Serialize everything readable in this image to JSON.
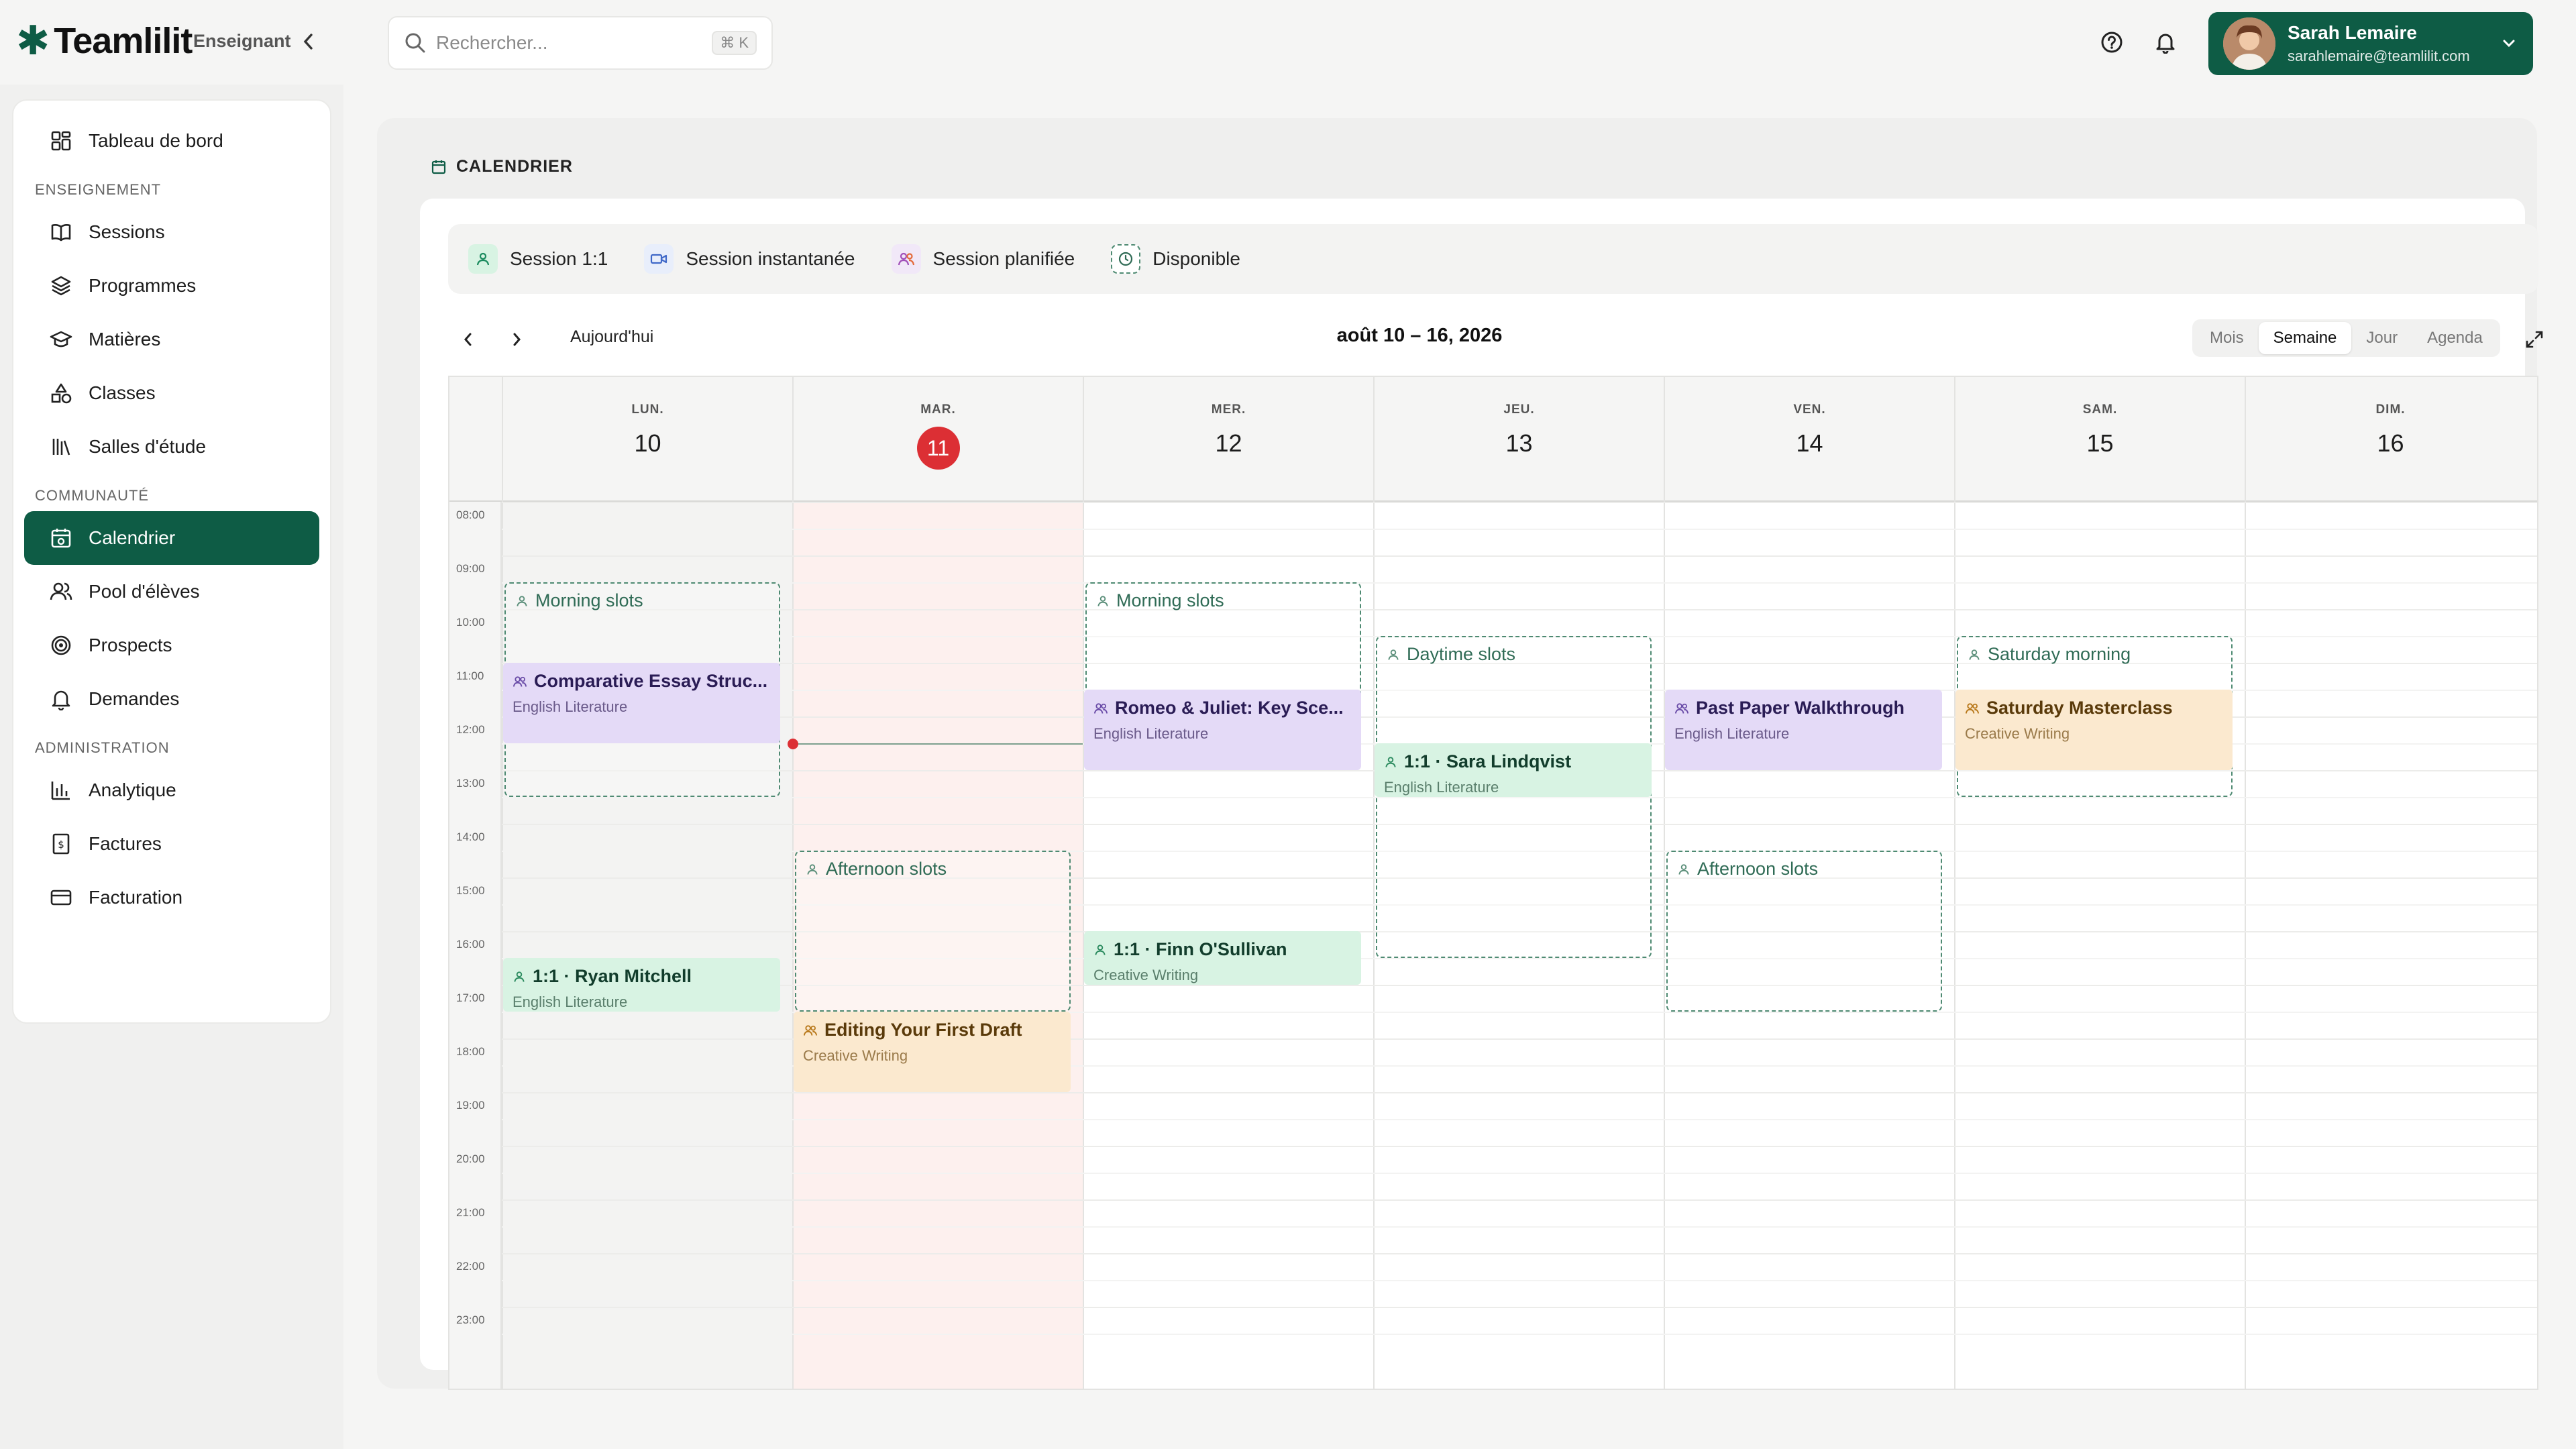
{
  "app": {
    "brand": "Teamlilit",
    "role": "Enseignant"
  },
  "search": {
    "placeholder": "Rechercher...",
    "shortcut": "⌘ K"
  },
  "user": {
    "name": "Sarah Lemaire",
    "email": "sarahlemaire@teamlilit.com"
  },
  "sidebar": {
    "top_item": "Tableau de bord",
    "sections": [
      {
        "label": "ENSEIGNEMENT",
        "items": [
          "Sessions",
          "Programmes",
          "Matières",
          "Classes",
          "Salles d'étude"
        ]
      },
      {
        "label": "COMMUNAUTÉ",
        "items": [
          "Calendrier",
          "Pool d'élèves",
          "Prospects",
          "Demandes"
        ]
      },
      {
        "label": "ADMINISTRATION",
        "items": [
          "Analytique",
          "Factures",
          "Facturation"
        ]
      }
    ],
    "active": "Calendrier"
  },
  "page": {
    "title": "CALENDRIER"
  },
  "legend": [
    {
      "label": "Session 1:1",
      "icon": "user-icon",
      "color": "#d8f3e3"
    },
    {
      "label": "Session instantanée",
      "icon": "video-icon",
      "color": "#e8eefb"
    },
    {
      "label": "Session planifiée",
      "icon": "users-icon",
      "color": "#f1e8f8"
    },
    {
      "label": "Disponible",
      "icon": "clock-icon",
      "color": "#ffffff"
    }
  ],
  "toolbar": {
    "today": "Aujourd'hui",
    "range": "août 10 – 16, 2026",
    "views": [
      "Mois",
      "Semaine",
      "Jour",
      "Agenda"
    ],
    "active_view": "Semaine"
  },
  "calendar": {
    "days": [
      {
        "dow": "LUN.",
        "num": "10"
      },
      {
        "dow": "MAR.",
        "num": "11",
        "today": true
      },
      {
        "dow": "MER.",
        "num": "12"
      },
      {
        "dow": "JEU.",
        "num": "13"
      },
      {
        "dow": "VEN.",
        "num": "14"
      },
      {
        "dow": "SAM.",
        "num": "15"
      },
      {
        "dow": "DIM.",
        "num": "16"
      }
    ],
    "hours": [
      "08:00",
      "09:00",
      "10:00",
      "11:00",
      "12:00",
      "13:00",
      "14:00",
      "15:00",
      "16:00",
      "17:00",
      "18:00",
      "19:00",
      "20:00",
      "21:00",
      "22:00",
      "23:00"
    ],
    "now": "12:00",
    "slots": [
      {
        "day": 0,
        "start": "09:00",
        "end": "13:00",
        "title": "Morning slots"
      },
      {
        "day": 2,
        "start": "09:00",
        "end": "12:00",
        "title": "Morning slots"
      },
      {
        "day": 3,
        "start": "10:00",
        "end": "16:00",
        "title": "Daytime slots"
      },
      {
        "day": 5,
        "start": "10:00",
        "end": "13:00",
        "title": "Saturday morning"
      },
      {
        "day": 1,
        "start": "14:00",
        "end": "17:00",
        "title": "Afternoon slots"
      },
      {
        "day": 4,
        "start": "14:00",
        "end": "17:00",
        "title": "Afternoon slots"
      }
    ],
    "events": [
      {
        "day": 0,
        "start": "10:30",
        "end": "12:00",
        "kind": "purple",
        "title": "Comparative Essay Struc...",
        "sub": "English Literature",
        "icon": "users-icon"
      },
      {
        "day": 0,
        "start": "16:00",
        "end": "17:00",
        "kind": "green",
        "title": "1:1 · Ryan Mitchell",
        "sub": "English Literature",
        "icon": "user-icon"
      },
      {
        "day": 1,
        "start": "17:00",
        "end": "18:30",
        "kind": "orange",
        "title": "Editing Your First Draft",
        "sub": "Creative Writing",
        "icon": "users-icon"
      },
      {
        "day": 2,
        "start": "11:00",
        "end": "12:30",
        "kind": "purple",
        "title": "Romeo & Juliet: Key Sce...",
        "sub": "English Literature",
        "icon": "users-icon"
      },
      {
        "day": 2,
        "start": "15:30",
        "end": "16:30",
        "kind": "green",
        "title": "1:1 · Finn O'Sullivan",
        "sub": "Creative Writing",
        "icon": "user-icon"
      },
      {
        "day": 3,
        "start": "12:00",
        "end": "13:00",
        "kind": "green",
        "title": "1:1 · Sara Lindqvist",
        "sub": "English Literature",
        "icon": "user-icon"
      },
      {
        "day": 4,
        "start": "11:00",
        "end": "12:30",
        "kind": "purple",
        "title": "Past Paper Walkthrough",
        "sub": "English Literature",
        "icon": "users-icon"
      },
      {
        "day": 5,
        "start": "11:00",
        "end": "12:30",
        "kind": "orange",
        "title": "Saturday Masterclass",
        "sub": "Creative Writing",
        "icon": "users-icon"
      }
    ]
  }
}
